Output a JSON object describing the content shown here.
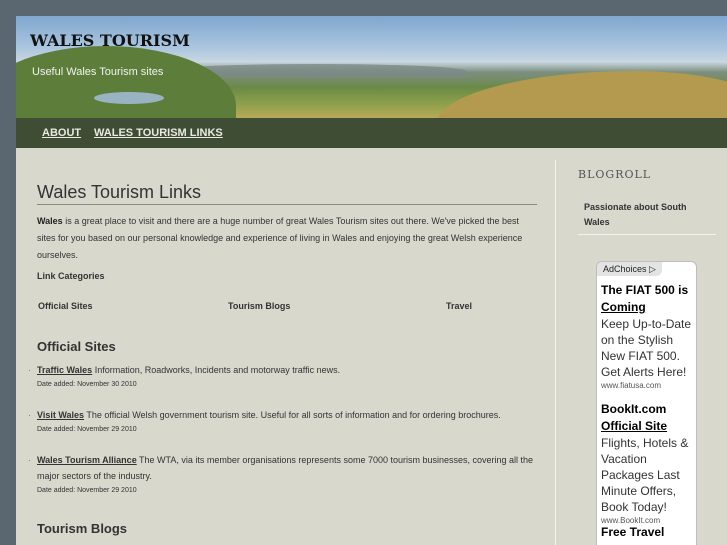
{
  "site": {
    "title": "WALES TOURISM",
    "tagline": "Useful Wales Tourism sites"
  },
  "nav": [
    {
      "label": "ABOUT"
    },
    {
      "label": "WALES TOURISM LINKS"
    }
  ],
  "page": {
    "title": "Wales Tourism Links",
    "intro_bold": "Wales",
    "intro_rest": " is a great place to visit and there are a huge number of great Wales Tourism sites out there. We've picked the best sites for you based on our personal knowledge and experience of living in Wales and enjoying the great Welsh experience ourselves.",
    "categories_heading": "Link Categories",
    "categories": [
      "Official Sites",
      "Tourism Blogs",
      "Travel"
    ]
  },
  "sections": {
    "official": {
      "heading": "Official Sites",
      "items": [
        {
          "link": "Traffic Wales",
          "desc": " Information, Roadworks, Incidents and motorway traffic news.",
          "date": "Date added: November 30 2010"
        },
        {
          "link": "Visit Wales",
          "desc": " The official Welsh government tourism site. Useful for all sorts of information and for ordering brochures.",
          "date": "Date added: November 29 2010"
        },
        {
          "link": "Wales Tourism Alliance",
          "desc": " The WTA, via its member organisations represents some 7000 tourism businesses, covering all the major sectors of the industry.",
          "date": "Date added: November 29 2010"
        }
      ]
    },
    "blogs": {
      "heading": "Tourism Blogs"
    }
  },
  "sidebar": {
    "blogroll_title": "BLOGROLL",
    "blogroll_link": "Passionate about South Wales"
  },
  "ad": {
    "adchoices": "AdChoices",
    "ads": [
      {
        "title1": "The FIAT 500 is",
        "title2": "Coming",
        "desc": "Keep Up-to-Date on the Stylish New FIAT 500. Get Alerts Here!",
        "url": "www.fiatusa.com"
      },
      {
        "title1": "BookIt.com",
        "title2": "Official Site",
        "desc": "Flights, Hotels & Vacation Packages Last Minute Offers, Book Today!",
        "url": "www.BookIt.com"
      },
      {
        "title1": "Free Travel",
        "title2": "",
        "desc": "",
        "url": ""
      }
    ]
  }
}
